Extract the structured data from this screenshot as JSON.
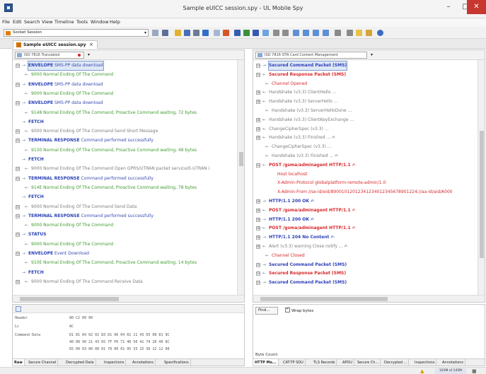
{
  "window": {
    "title": "Sample eUICC session.spy - UL Mobile Spy",
    "min": "–",
    "max": "□",
    "close": "✕"
  },
  "menu": [
    "File",
    "Edit",
    "Search",
    "View",
    "Timeline",
    "Tools",
    "Window",
    "Help"
  ],
  "toolbar": {
    "session": "Socket Session"
  },
  "doc_tab": {
    "label": "Sample eUICC session.spy",
    "close": "×"
  },
  "left_pane": {
    "mode": "ISO 7816 Translated",
    "rows": [
      {
        "exp": "⊟",
        "cmd": "ENVELOPE",
        "desc": "SMS-PP data download",
        "kind": "cmd",
        "selected": true
      },
      {
        "exp": "",
        "cmd": "",
        "desc": "9000 Normal Ending Of The Command",
        "kind": "resp"
      },
      {
        "exp": "⊟",
        "cmd": "ENVELOPE",
        "desc": "SMS-PP data download",
        "kind": "cmd"
      },
      {
        "exp": "",
        "cmd": "",
        "desc": "9000 Normal Ending Of The Command",
        "kind": "resp"
      },
      {
        "exp": "⊟",
        "cmd": "ENVELOPE",
        "desc": "SMS-PP data download",
        "kind": "cmd"
      },
      {
        "exp": "",
        "cmd": "",
        "desc": "9148 Normal Ending Of The Command, Proactive Command waiting, 72 bytes",
        "kind": "resp"
      },
      {
        "exp": "",
        "cmd": "FETCH",
        "desc": "",
        "kind": "cmd"
      },
      {
        "exp": "⊟",
        "cmd": "",
        "desc": "9000 Normal Ending Of The Command  Send Short Message",
        "kind": "gray"
      },
      {
        "exp": "⊟",
        "cmd": "TERMINAL RESPONSE",
        "desc": "Command performed successfully",
        "kind": "cmd"
      },
      {
        "exp": "",
        "cmd": "",
        "desc": "9130 Normal Ending Of The Command, Proactive Command waiting, 48 bytes",
        "kind": "resp"
      },
      {
        "exp": "",
        "cmd": "FETCH",
        "desc": "",
        "kind": "cmd"
      },
      {
        "exp": "⊟",
        "cmd": "",
        "desc": "9000 Normal Ending Of The Command  Open GPRS/UTRAN packet service/E-UTRAN i",
        "kind": "gray"
      },
      {
        "exp": "⊟",
        "cmd": "TERMINAL RESPONSE",
        "desc": "Command performed successfully",
        "kind": "cmd"
      },
      {
        "exp": "",
        "cmd": "",
        "desc": "914E Normal Ending Of The Command, Proactive Command waiting, 78 bytes",
        "kind": "resp"
      },
      {
        "exp": "",
        "cmd": "FETCH",
        "desc": "",
        "kind": "cmd"
      },
      {
        "exp": "⊟",
        "cmd": "",
        "desc": "9000 Normal Ending Of The Command  Send Data",
        "kind": "gray"
      },
      {
        "exp": "⊟",
        "cmd": "TERMINAL RESPONSE",
        "desc": "Command performed successfully",
        "kind": "cmd"
      },
      {
        "exp": "",
        "cmd": "",
        "desc": "9000 Normal Ending Of The Command",
        "kind": "resp"
      },
      {
        "exp": "⊟",
        "cmd": "STATUS",
        "desc": "",
        "kind": "cmd"
      },
      {
        "exp": "",
        "cmd": "",
        "desc": "9000 Normal Ending Of The Command",
        "kind": "resp"
      },
      {
        "exp": "⊟",
        "cmd": "ENVELOPE",
        "desc": "Event Download",
        "kind": "cmd"
      },
      {
        "exp": "",
        "cmd": "",
        "desc": "910E Normal Ending Of The Command, Proactive Command waiting, 14 bytes",
        "kind": "resp"
      },
      {
        "exp": "",
        "cmd": "FETCH",
        "desc": "",
        "kind": "cmd"
      },
      {
        "exp": "⊟",
        "cmd": "",
        "desc": "9000 Normal Ending Of The Command  Receive Data",
        "kind": "gray"
      }
    ]
  },
  "right_pane": {
    "mode": "ISO 7816  OTA Card Content Management",
    "rows": [
      {
        "exp": "⊟",
        "text": "Secured Command Packet (SMS)",
        "kind": "blue",
        "selected": true
      },
      {
        "exp": "⊟",
        "text": "Secured Response Packet (SMS)",
        "kind": "red"
      },
      {
        "exp": "",
        "text": "Channel Opened",
        "kind": "redn"
      },
      {
        "exp": "⊞",
        "text": "Handshake (v3.3)  ClientHello  ...",
        "kind": "gray"
      },
      {
        "exp": "⊞",
        "text": "Handshake (v3.3)  ServerHello  ...",
        "kind": "gray"
      },
      {
        "exp": "",
        "text": "Handshake (v3.3)  ServerHelloDone  ...",
        "kind": "gray"
      },
      {
        "exp": "⊞",
        "text": "Handshake (v3.3)  ClientKeyExchange  ...",
        "kind": "gray"
      },
      {
        "exp": "⊞",
        "text": "ChangeCipherSpec (v3.3)  ...",
        "kind": "gray"
      },
      {
        "exp": "⊞",
        "text": "Handshake (v3.3)  Finished  ... ✍",
        "kind": "gray"
      },
      {
        "exp": "",
        "text": "ChangeCipherSpec (v3.3)  ...",
        "kind": "gray"
      },
      {
        "exp": "",
        "text": "Handshake (v3.3)  Finished  ... ✍",
        "kind": "gray"
      },
      {
        "exp": "⊟",
        "text": "POST /gsma/adminagent HTTP/1.1  ✍",
        "kind": "red"
      },
      {
        "exp": "",
        "text": "Host localhost",
        "kind": "redn",
        "indent": true
      },
      {
        "exp": "",
        "text": "X-Admin-Protocol  globalplatform-remote-admin/1.0",
        "kind": "redn",
        "indent": true
      },
      {
        "exp": "",
        "text": "X-Admin-From  //se-id/eid/89001012012341234012345678901224;//aa-id/aid/A000",
        "kind": "redn",
        "indent": true
      },
      {
        "exp": "⊞",
        "text": "HTTP/1.1 200 OK  ✍",
        "kind": "blue"
      },
      {
        "exp": "⊞",
        "text": "POST /gsma/adminagent HTTP/1.1  ✍",
        "kind": "red"
      },
      {
        "exp": "⊞",
        "text": "HTTP/1.1 200 OK  ✍",
        "kind": "blue"
      },
      {
        "exp": "⊞",
        "text": "POST /gsma/adminagent HTTP/1.1  ✍",
        "kind": "red"
      },
      {
        "exp": "⊞",
        "text": "HTTP/1.1 204 No Content  ✍",
        "kind": "blue"
      },
      {
        "exp": "⊞",
        "text": "Alert (v3.3)  warning  Close notify  ... ✍",
        "kind": "gray"
      },
      {
        "exp": "",
        "text": "Channel Closed",
        "kind": "redn"
      },
      {
        "exp": "⊟",
        "text": "Secured Command Packet (SMS)",
        "kind": "blue"
      },
      {
        "exp": "⊟",
        "text": "Secured Response Packet (SMS)",
        "kind": "red"
      },
      {
        "exp": "⊟",
        "text": "Secured Command Packet (SMS)",
        "kind": "blue"
      }
    ]
  },
  "hex_view": {
    "lines": [
      {
        "label": "Header",
        "hex": "80 C2 00 00"
      },
      {
        "label": "Lc",
        "hex": "AC"
      },
      {
        "label": "Command Data",
        "hex": "D1 81 A9 02 02 83 81 06 04 81 21 43 65 08 81 9C"
      },
      {
        "label": "",
        "hex": "40 08 90 21 43 65 7F F6 71 40 50 41 74 20 40 8C"
      },
      {
        "label": "",
        "hex": "65 00 03 00 00 01 70 00 01 95 33 15 36 12 12 00"
      }
    ]
  },
  "left_tabs": [
    "Raw",
    "Secure Channel",
    "Decrypted Data",
    "Inspections",
    "Annotations",
    "Specifications"
  ],
  "right_bottom": {
    "find": "Find...",
    "wrap": "Wrap bytes",
    "byte_count": "Byte Count:"
  },
  "right_tabs": [
    "HTTP Me...",
    "CAT-TP SDU",
    "TLS Records",
    "APDU",
    "Secure Ch...",
    "Decrypted ...",
    "Inspections",
    "Annotations"
  ],
  "status": {
    "memory": "103M of 145M"
  },
  "colors": {
    "command": "#2a42b5",
    "response": "#3f9b2f",
    "error": "#d7282b"
  }
}
